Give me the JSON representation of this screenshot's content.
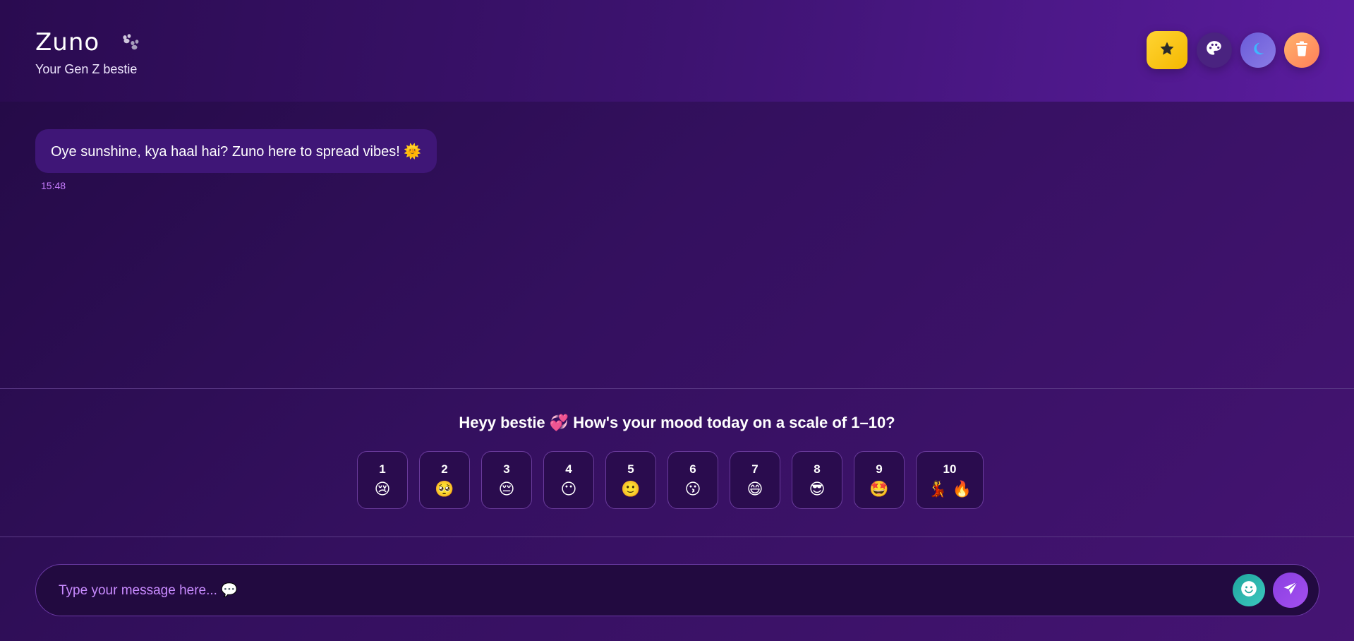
{
  "header": {
    "title": "Zuno",
    "subtitle": "Your Gen Z bestie",
    "title_icon": "paw-icon",
    "buttons": [
      {
        "name": "favorites",
        "icon": "star-icon",
        "color": "#f5c518"
      },
      {
        "name": "theme",
        "icon": "palette-icon",
        "color": "#4a2380"
      },
      {
        "name": "dark-mode",
        "icon": "moon-icon",
        "color": "#7a6be0"
      },
      {
        "name": "clear-chat",
        "icon": "trash-icon",
        "color": "#ff9566"
      }
    ]
  },
  "chat": {
    "messages": [
      {
        "text": "Oye sunshine, kya haal hai? Zuno here to spread vibes! 🌞",
        "time": "15:48"
      }
    ]
  },
  "mood": {
    "question": "Heyy bestie 💞 How's your mood today on a scale of 1–10?",
    "options": [
      {
        "value": "1",
        "emoji": "😢"
      },
      {
        "value": "2",
        "emoji": "🥺"
      },
      {
        "value": "3",
        "emoji": "😔"
      },
      {
        "value": "4",
        "emoji": "😶"
      },
      {
        "value": "5",
        "emoji": "🙂"
      },
      {
        "value": "6",
        "emoji": "😗"
      },
      {
        "value": "7",
        "emoji": "😄"
      },
      {
        "value": "8",
        "emoji": "😎"
      },
      {
        "value": "9",
        "emoji": "🤩"
      },
      {
        "value": "10",
        "emoji": "💃 🔥"
      }
    ]
  },
  "composer": {
    "placeholder": "Type your message here... 💬",
    "value": ""
  },
  "colors": {
    "accent": "#a44ff0",
    "timestamp": "#c87dff",
    "background": "#34105f"
  }
}
